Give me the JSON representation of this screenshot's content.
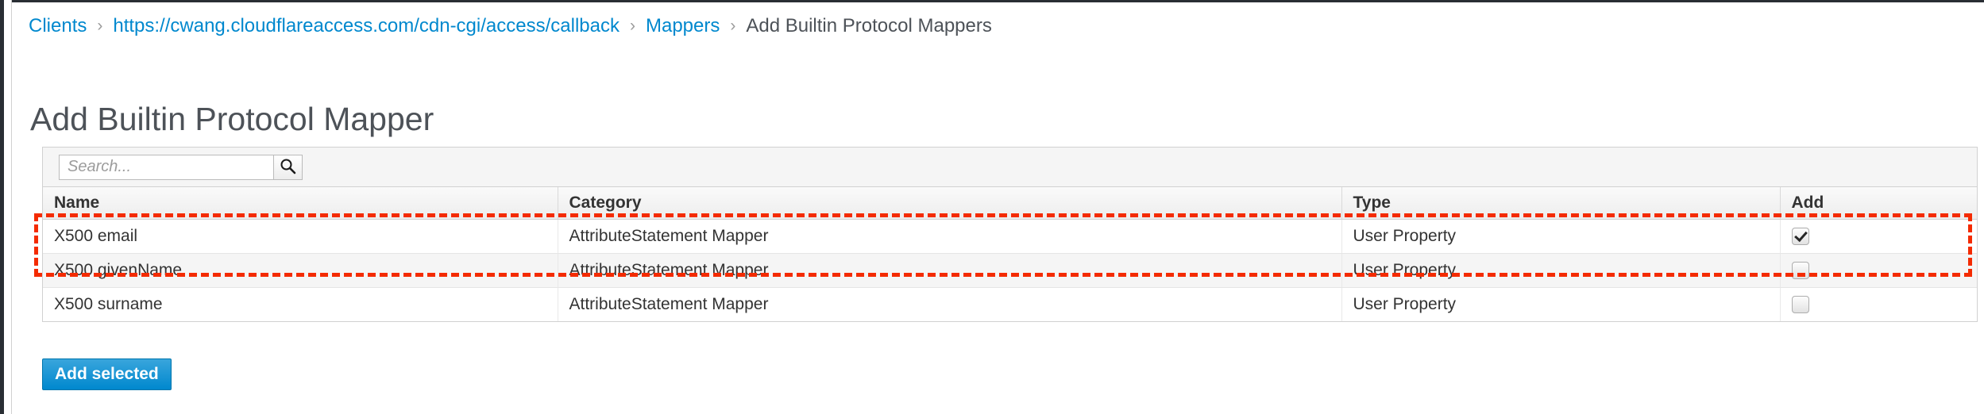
{
  "breadcrumb": {
    "items": [
      {
        "label": "Clients",
        "link": true
      },
      {
        "label": "https://cwang.cloudflareaccess.com/cdn-cgi/access/callback",
        "link": true
      },
      {
        "label": "Mappers",
        "link": true
      },
      {
        "label": "Add Builtin Protocol Mappers",
        "link": false
      }
    ],
    "separator": "›"
  },
  "page": {
    "title": "Add Builtin Protocol Mapper"
  },
  "toolbar": {
    "search_value": "",
    "search_placeholder": "Search...",
    "search_button_icon": "search-icon"
  },
  "table": {
    "columns": [
      "Name",
      "Category",
      "Type",
      "Add"
    ],
    "rows": [
      {
        "name": "X500 email",
        "category": "AttributeStatement Mapper",
        "type": "User Property",
        "add_checked": true
      },
      {
        "name": "X500 givenName",
        "category": "AttributeStatement Mapper",
        "type": "User Property",
        "add_checked": false
      },
      {
        "name": "X500 surname",
        "category": "AttributeStatement Mapper",
        "type": "User Property",
        "add_checked": false
      }
    ]
  },
  "actions": {
    "add_selected_label": "Add selected"
  },
  "annotation": {
    "color": "#f42b00",
    "style": "dashed-rectangle",
    "targets_row": "X500 email"
  },
  "colors": {
    "link": "#0088ce",
    "primary_button": "#0088ce",
    "text": "#4d5258",
    "panel_border": "#d1d1d1",
    "rail_dark": "#292e34"
  }
}
